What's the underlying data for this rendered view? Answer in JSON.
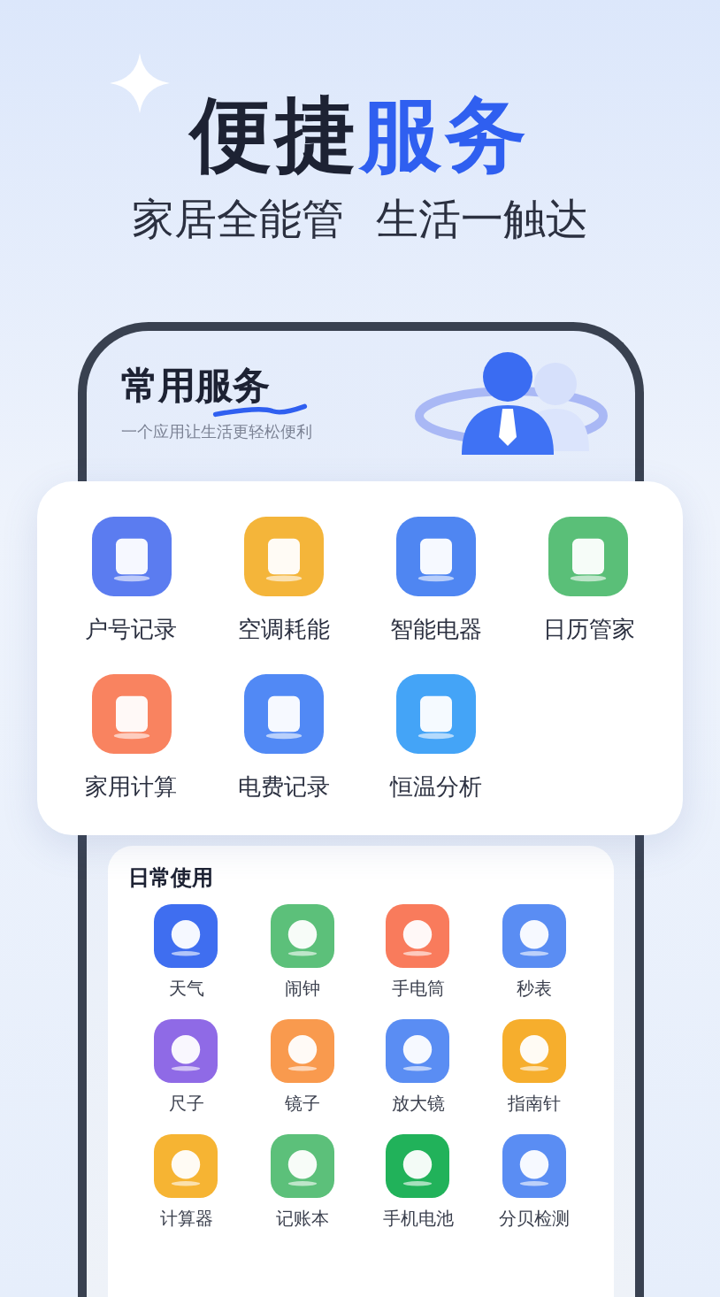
{
  "headline": {
    "plain": "便捷",
    "accent": "服务"
  },
  "tagline": [
    "家居全能管",
    "生活一触达"
  ],
  "phone": {
    "title_plain": "常用服务",
    "subtitle": "一个应用让生活更轻松便利"
  },
  "services": [
    {
      "label": "户号记录",
      "color": "#5b7cf0"
    },
    {
      "label": "空调耗能",
      "color": "#f4b53a"
    },
    {
      "label": "智能电器",
      "color": "#4f86f2"
    },
    {
      "label": "日历管家",
      "color": "#5abf78"
    },
    {
      "label": "家用计算",
      "color": "#f98360"
    },
    {
      "label": "电费记录",
      "color": "#5189f5"
    },
    {
      "label": "恒温分析",
      "color": "#44a4f7"
    }
  ],
  "daily": {
    "title": "日常使用",
    "items": [
      {
        "label": "天气",
        "color": "#3f6ef0"
      },
      {
        "label": "闹钟",
        "color": "#5cc07a"
      },
      {
        "label": "手电筒",
        "color": "#f97b5c"
      },
      {
        "label": "秒表",
        "color": "#5a8df3"
      },
      {
        "label": "尺子",
        "color": "#8f6ae6"
      },
      {
        "label": "镜子",
        "color": "#f99a4e"
      },
      {
        "label": "放大镜",
        "color": "#5a8df3"
      },
      {
        "label": "指南针",
        "color": "#f6ae2d"
      },
      {
        "label": "计算器",
        "color": "#f6b433"
      },
      {
        "label": "记账本",
        "color": "#5cc07a"
      },
      {
        "label": "手机电池",
        "color": "#21b25a"
      },
      {
        "label": "分贝检测",
        "color": "#5a8df3"
      }
    ]
  }
}
